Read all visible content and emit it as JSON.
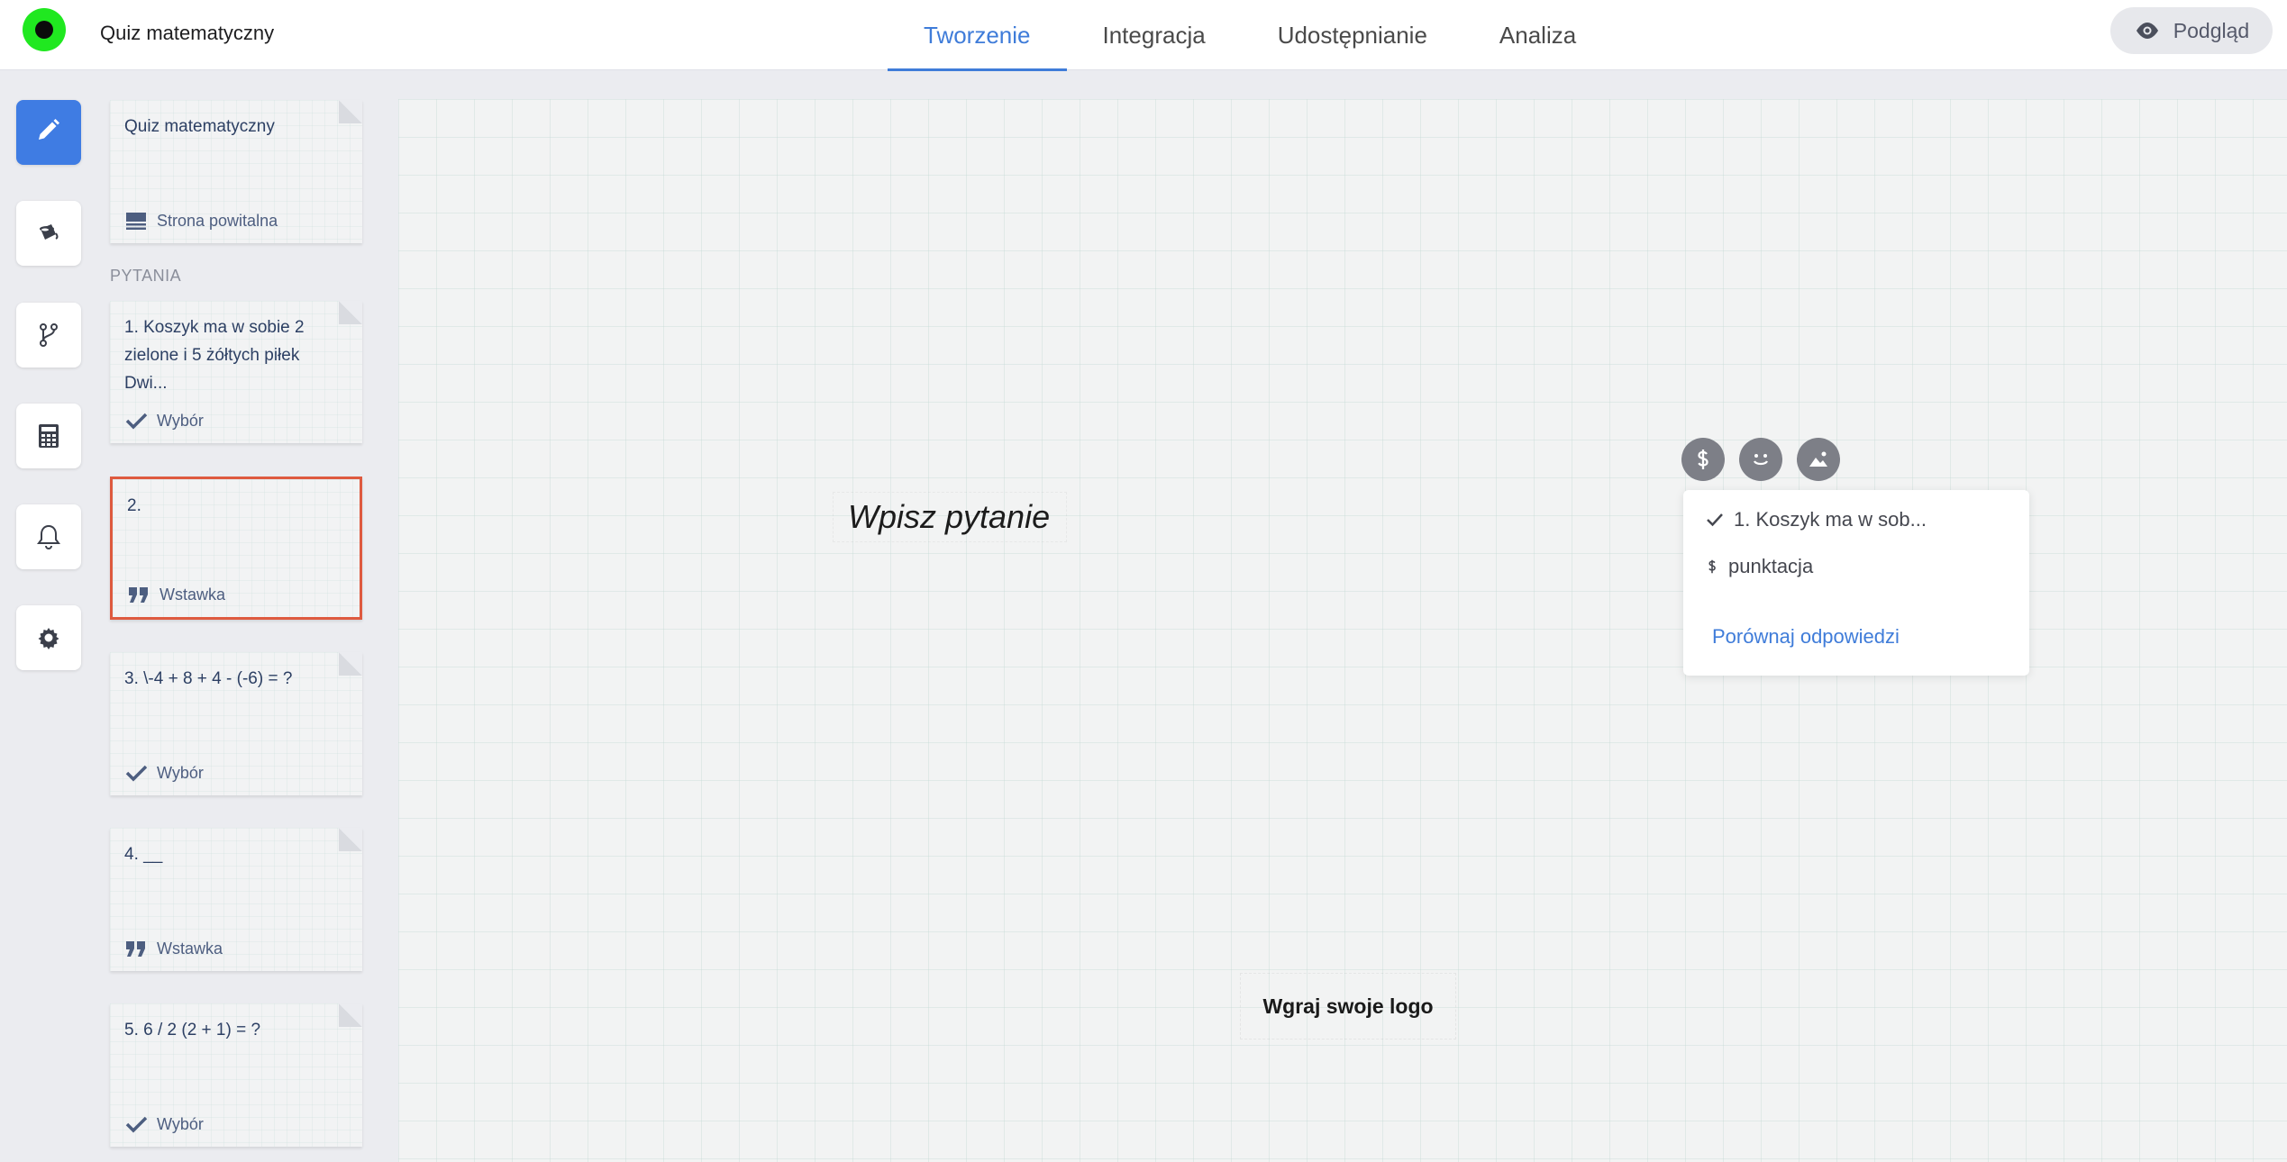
{
  "app": {
    "title": "Quiz matematyczny"
  },
  "tabs": [
    {
      "label": "Tworzenie"
    },
    {
      "label": "Integracja"
    },
    {
      "label": "Udostępnianie"
    },
    {
      "label": "Analiza"
    }
  ],
  "preview": {
    "label": "Podgląd",
    "icon": "eye-icon"
  },
  "rail": [
    {
      "icon": "pencil-icon"
    },
    {
      "icon": "paint-bucket-icon"
    },
    {
      "icon": "branch-icon"
    },
    {
      "icon": "calculator-icon"
    },
    {
      "icon": "bell-icon"
    },
    {
      "icon": "gear-icon"
    }
  ],
  "welcome": {
    "title": "Quiz matematyczny",
    "type": "Strona powitalna"
  },
  "questions_label": "PYTANIA",
  "questions": [
    {
      "text": "1. Koszyk ma w sobie 2 zielone i 5 żółtych piłek Dwi...",
      "type": "Wybór"
    },
    {
      "text": "2.",
      "type": "Wstawka"
    },
    {
      "text": "3. \\-4 + 8 + 4 - (-6) = ?",
      "type": "Wybór"
    },
    {
      "text": "4. __",
      "type": "Wstawka"
    },
    {
      "text": "5. 6 / 2 (2 + 1) = ?",
      "type": "Wybór"
    }
  ],
  "editor": {
    "placeholder": "Wpisz pytanie",
    "upload_logo": "Wgraj swoje logo"
  },
  "popover": {
    "items": [
      "1. Koszyk ma w sob...",
      "punktacja"
    ],
    "link": "Porównaj odpowiedzi"
  },
  "colors": {
    "accent": "#3f7cd9",
    "selected_border": "#de5a3f",
    "logo": "#20e820"
  }
}
